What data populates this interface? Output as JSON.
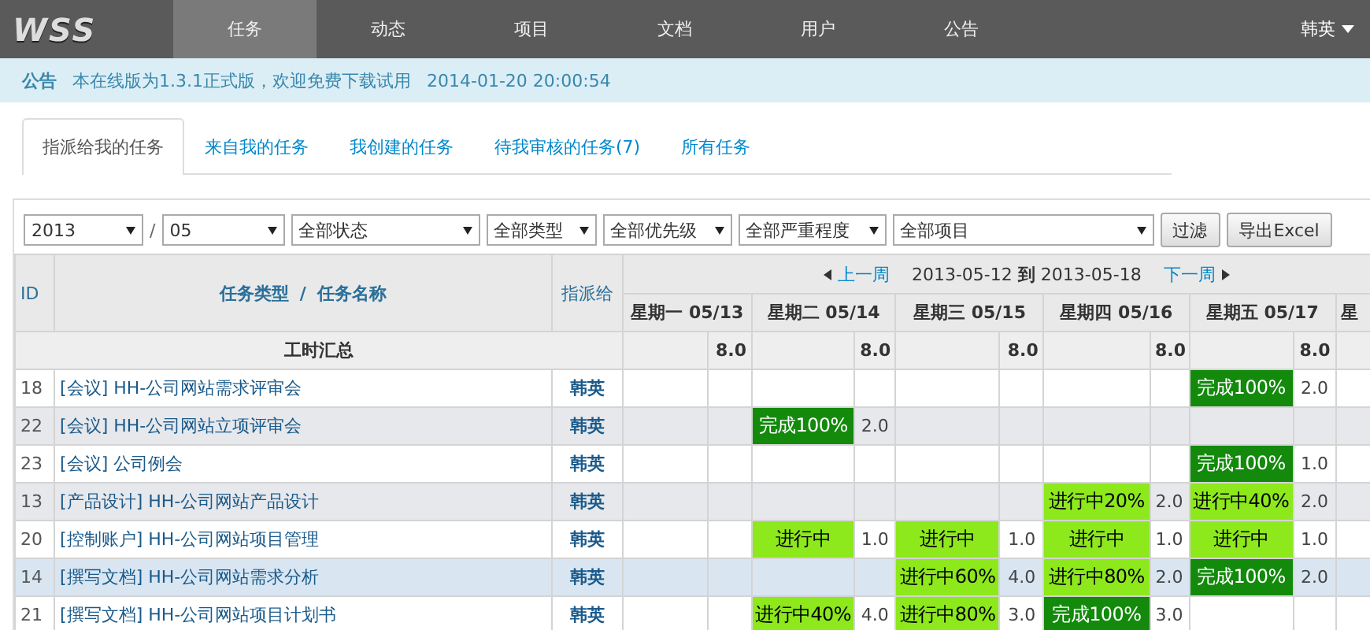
{
  "nav": {
    "logo": "WSS",
    "items": [
      {
        "label": "任务",
        "selected": true
      },
      {
        "label": "动态",
        "selected": false
      },
      {
        "label": "项目",
        "selected": false
      },
      {
        "label": "文档",
        "selected": false
      },
      {
        "label": "用户",
        "selected": false
      },
      {
        "label": "公告",
        "selected": false
      }
    ],
    "user": "韩英"
  },
  "notice": {
    "label": "公告",
    "text": "本在线版为1.3.1正式版，欢迎免费下载试用",
    "time": "2014-01-20 20:00:54"
  },
  "tabs": [
    {
      "label": "指派给我的任务",
      "selected": true
    },
    {
      "label": "来自我的任务",
      "selected": false
    },
    {
      "label": "我创建的任务",
      "selected": false
    },
    {
      "label": "待我审核的任务(7)",
      "selected": false
    },
    {
      "label": "所有任务",
      "selected": false
    }
  ],
  "filters": {
    "year": "2013",
    "separator": "/",
    "month": "05",
    "selects": [
      "全部状态",
      "全部类型",
      "全部优先级",
      "全部严重程度",
      "全部项目"
    ],
    "buttons": [
      "过滤",
      "导出Excel"
    ]
  },
  "table": {
    "columns": {
      "id": "ID",
      "type": "任务类型",
      "name_separator": "/",
      "name": "任务名称",
      "assignee": "指派给"
    },
    "week": {
      "prev": "上一周",
      "range": "2013-05-12 **到** 2013-05-18",
      "next": "下一周"
    },
    "days": [
      "星期一 05/13",
      "星期二 05/14",
      "星期三 05/15",
      "星期四 05/16",
      "星期五 05/17",
      "星"
    ],
    "summary": {
      "label": "工时汇总",
      "hours": [
        "8.0",
        "8.0",
        "8.0",
        "8.0",
        "8.0"
      ]
    },
    "rows": [
      {
        "id": "18",
        "task": "[会议] HH-公司网站需求评审会",
        "assignee": "韩英",
        "selected": false,
        "cells": [
          null,
          null,
          null,
          null,
          {
            "status": "完成100%",
            "kind": "done",
            "hours": "2.0"
          }
        ]
      },
      {
        "id": "22",
        "task": "[会议] HH-公司网站立项评审会",
        "assignee": "韩英",
        "selected": false,
        "cells": [
          null,
          {
            "status": "完成100%",
            "kind": "done",
            "hours": "2.0"
          },
          null,
          null,
          null
        ]
      },
      {
        "id": "23",
        "task": "[会议] 公司例会",
        "assignee": "韩英",
        "selected": false,
        "cells": [
          null,
          null,
          null,
          null,
          {
            "status": "完成100%",
            "kind": "done",
            "hours": "1.0"
          }
        ]
      },
      {
        "id": "13",
        "task": "[产品设计] HH-公司网站产品设计",
        "assignee": "韩英",
        "selected": false,
        "cells": [
          null,
          null,
          null,
          {
            "status": "进行中20%",
            "kind": "progress",
            "hours": "2.0"
          },
          {
            "status": "进行中40%",
            "kind": "progress",
            "hours": "2.0"
          }
        ]
      },
      {
        "id": "20",
        "task": "[控制账户] HH-公司网站项目管理",
        "assignee": "韩英",
        "selected": false,
        "cells": [
          null,
          {
            "status": "进行中",
            "kind": "progress",
            "hours": "1.0"
          },
          {
            "status": "进行中",
            "kind": "progress",
            "hours": "1.0"
          },
          {
            "status": "进行中",
            "kind": "progress",
            "hours": "1.0"
          },
          {
            "status": "进行中",
            "kind": "progress",
            "hours": "1.0"
          }
        ]
      },
      {
        "id": "14",
        "task": "[撰写文档] HH-公司网站需求分析",
        "assignee": "韩英",
        "selected": true,
        "cells": [
          null,
          null,
          {
            "status": "进行中60%",
            "kind": "progress",
            "hours": "4.0"
          },
          {
            "status": "进行中80%",
            "kind": "progress",
            "hours": "2.0"
          },
          {
            "status": "完成100%",
            "kind": "done",
            "hours": "2.0"
          }
        ]
      },
      {
        "id": "21",
        "task": "[撰写文档] HH-公司网站项目计划书",
        "assignee": "韩英",
        "selected": false,
        "cells": [
          null,
          {
            "status": "进行中40%",
            "kind": "progress",
            "hours": "4.0"
          },
          {
            "status": "进行中80%",
            "kind": "progress",
            "hours": "3.0"
          },
          {
            "status": "完成100%",
            "kind": "done",
            "hours": "3.0"
          },
          null
        ]
      }
    ]
  }
}
